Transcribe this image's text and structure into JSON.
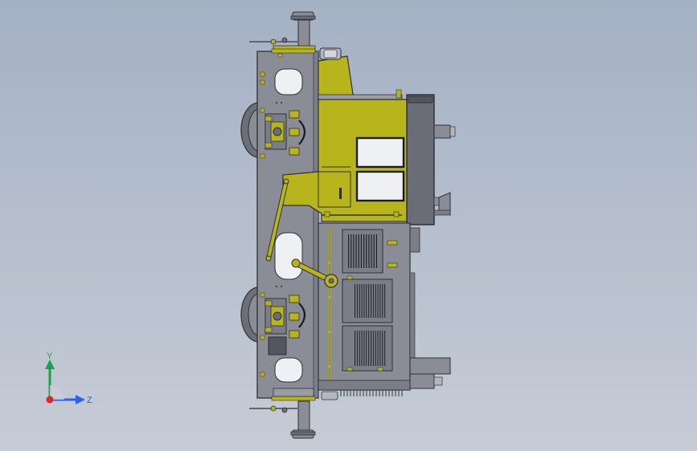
{
  "viewport": {
    "colors": {
      "background_top": "#a4b1c4",
      "background_bottom": "#c6ccd6",
      "body_grey": "#8a8c96",
      "body_edge": "#2e3038",
      "cab_yellow": "#b8b41c",
      "dark_grey": "#6a6d78",
      "black": "#1a1b1f"
    }
  },
  "model": {
    "name": "locomotive-side-view"
  },
  "triad": {
    "y_label": "Y",
    "z_label": "Z",
    "y_color": "#16a34a",
    "z_color": "#2563eb",
    "origin_color": "#dc2626"
  }
}
